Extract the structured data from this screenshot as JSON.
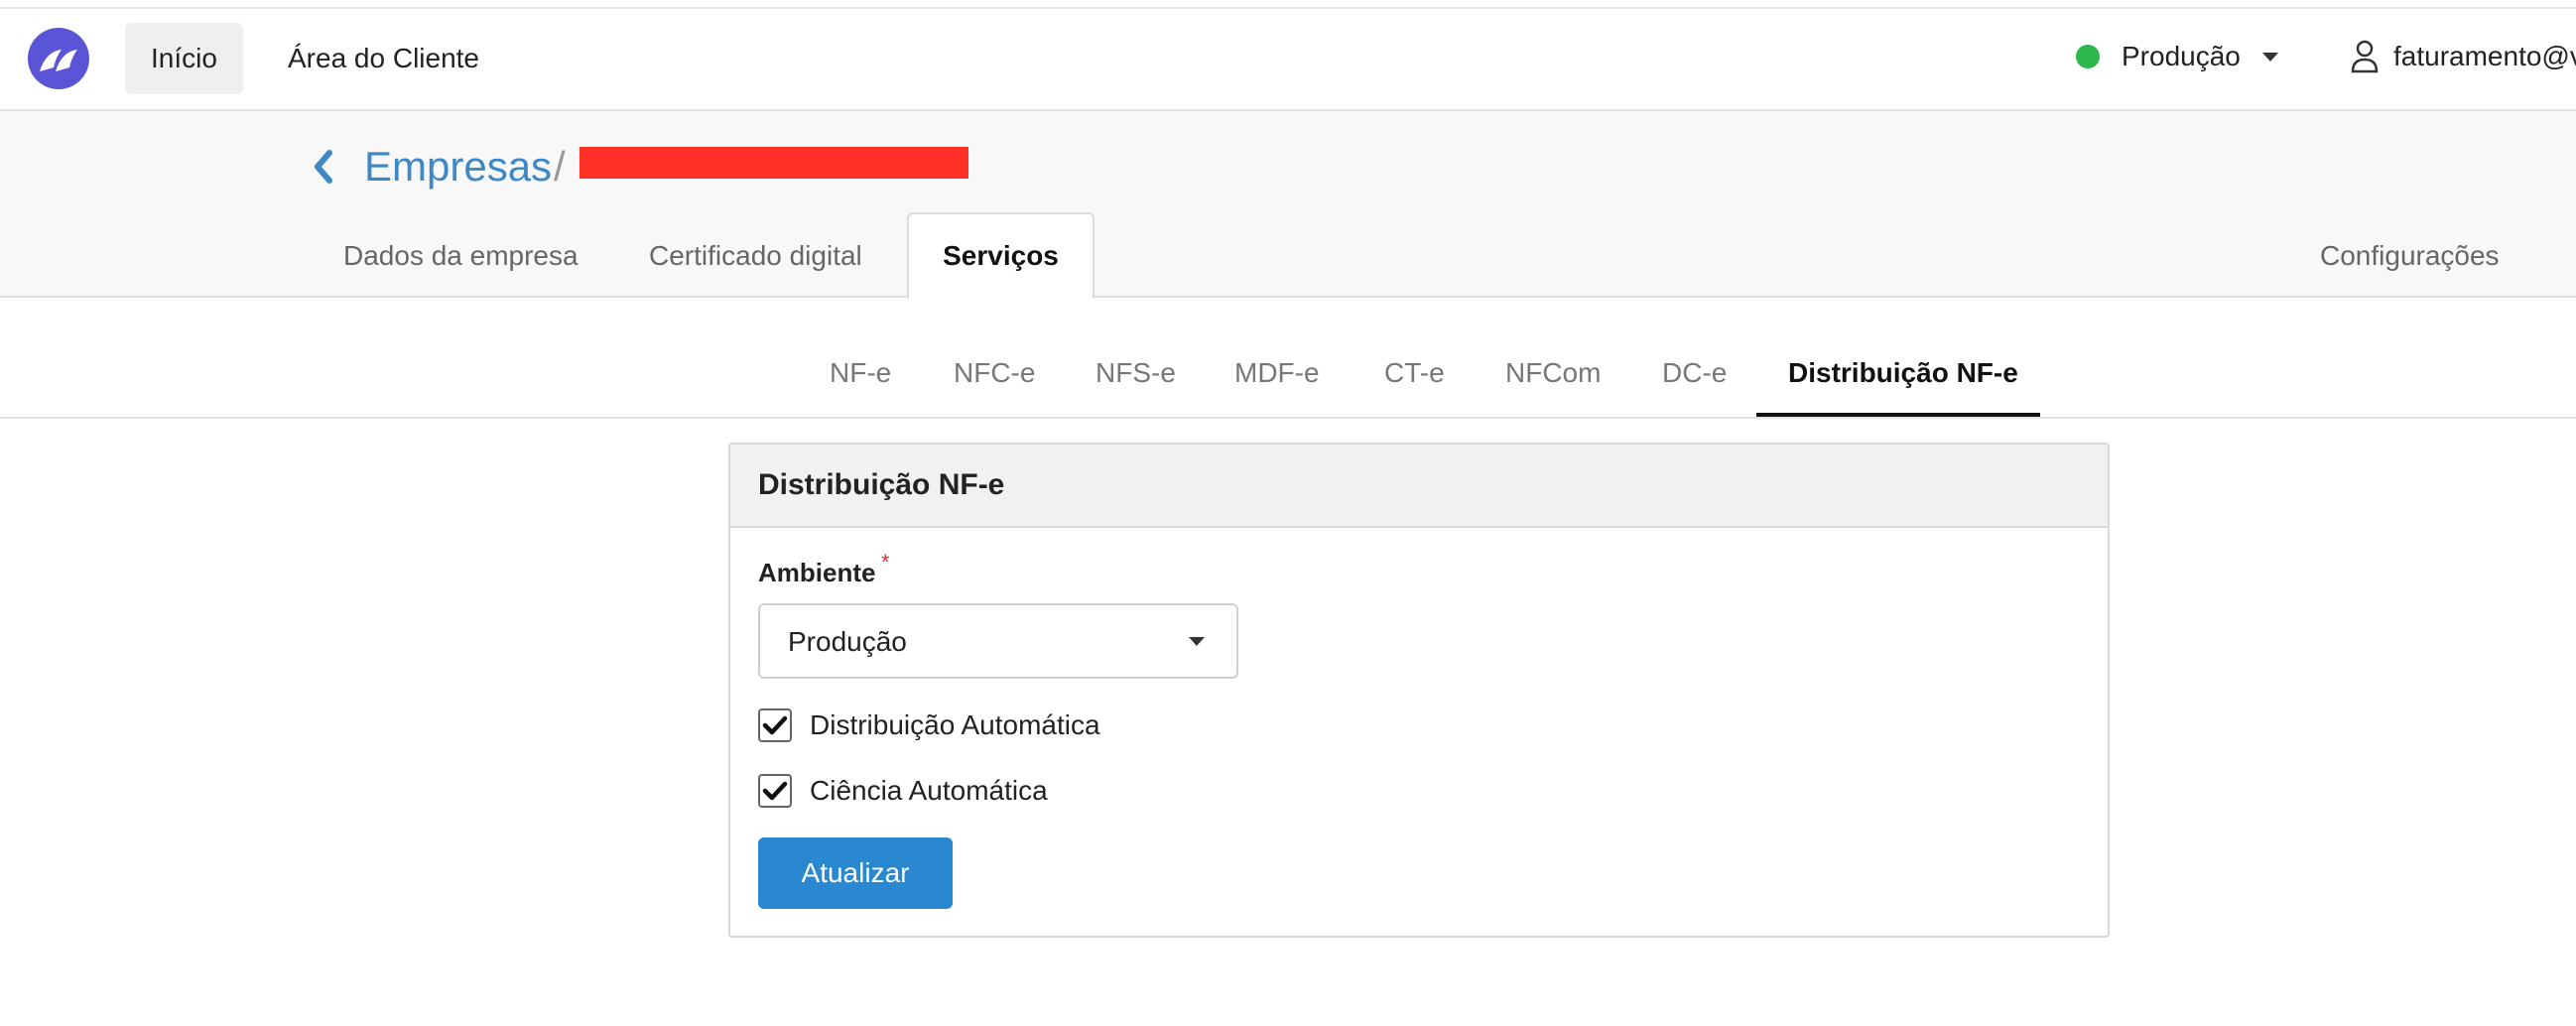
{
  "navbar": {
    "home_label": "Início",
    "client_area_label": "Área do Cliente",
    "environment_label": "Produção",
    "user_label": "faturamento@v"
  },
  "breadcrumb": {
    "link_label": "Empresas",
    "separator": "/"
  },
  "page_tabs": {
    "company_data": "Dados da empresa",
    "digital_certificate": "Certificado digital",
    "services": "Serviços",
    "settings": "Configurações"
  },
  "service_tabs": [
    "NF-e",
    "NFC-e",
    "NFS-e",
    "MDF-e",
    "CT-e",
    "NFCom",
    "DC-e",
    "Distribuição NF-e"
  ],
  "panel": {
    "title": "Distribuição NF-e",
    "environment_field_label": "Ambiente",
    "required_mark": "*",
    "environment_value": "Produção",
    "auto_distribution_label": "Distribuição Automática",
    "auto_distribution_checked": true,
    "auto_awareness_label": "Ciência Automática",
    "auto_awareness_checked": true,
    "submit_label": "Atualizar"
  },
  "colors": {
    "brand": "#5a55d6",
    "link": "#3e88c6",
    "status_ok": "#2db84d",
    "primary_button": "#2a88d0",
    "redaction": "#ff3126"
  }
}
